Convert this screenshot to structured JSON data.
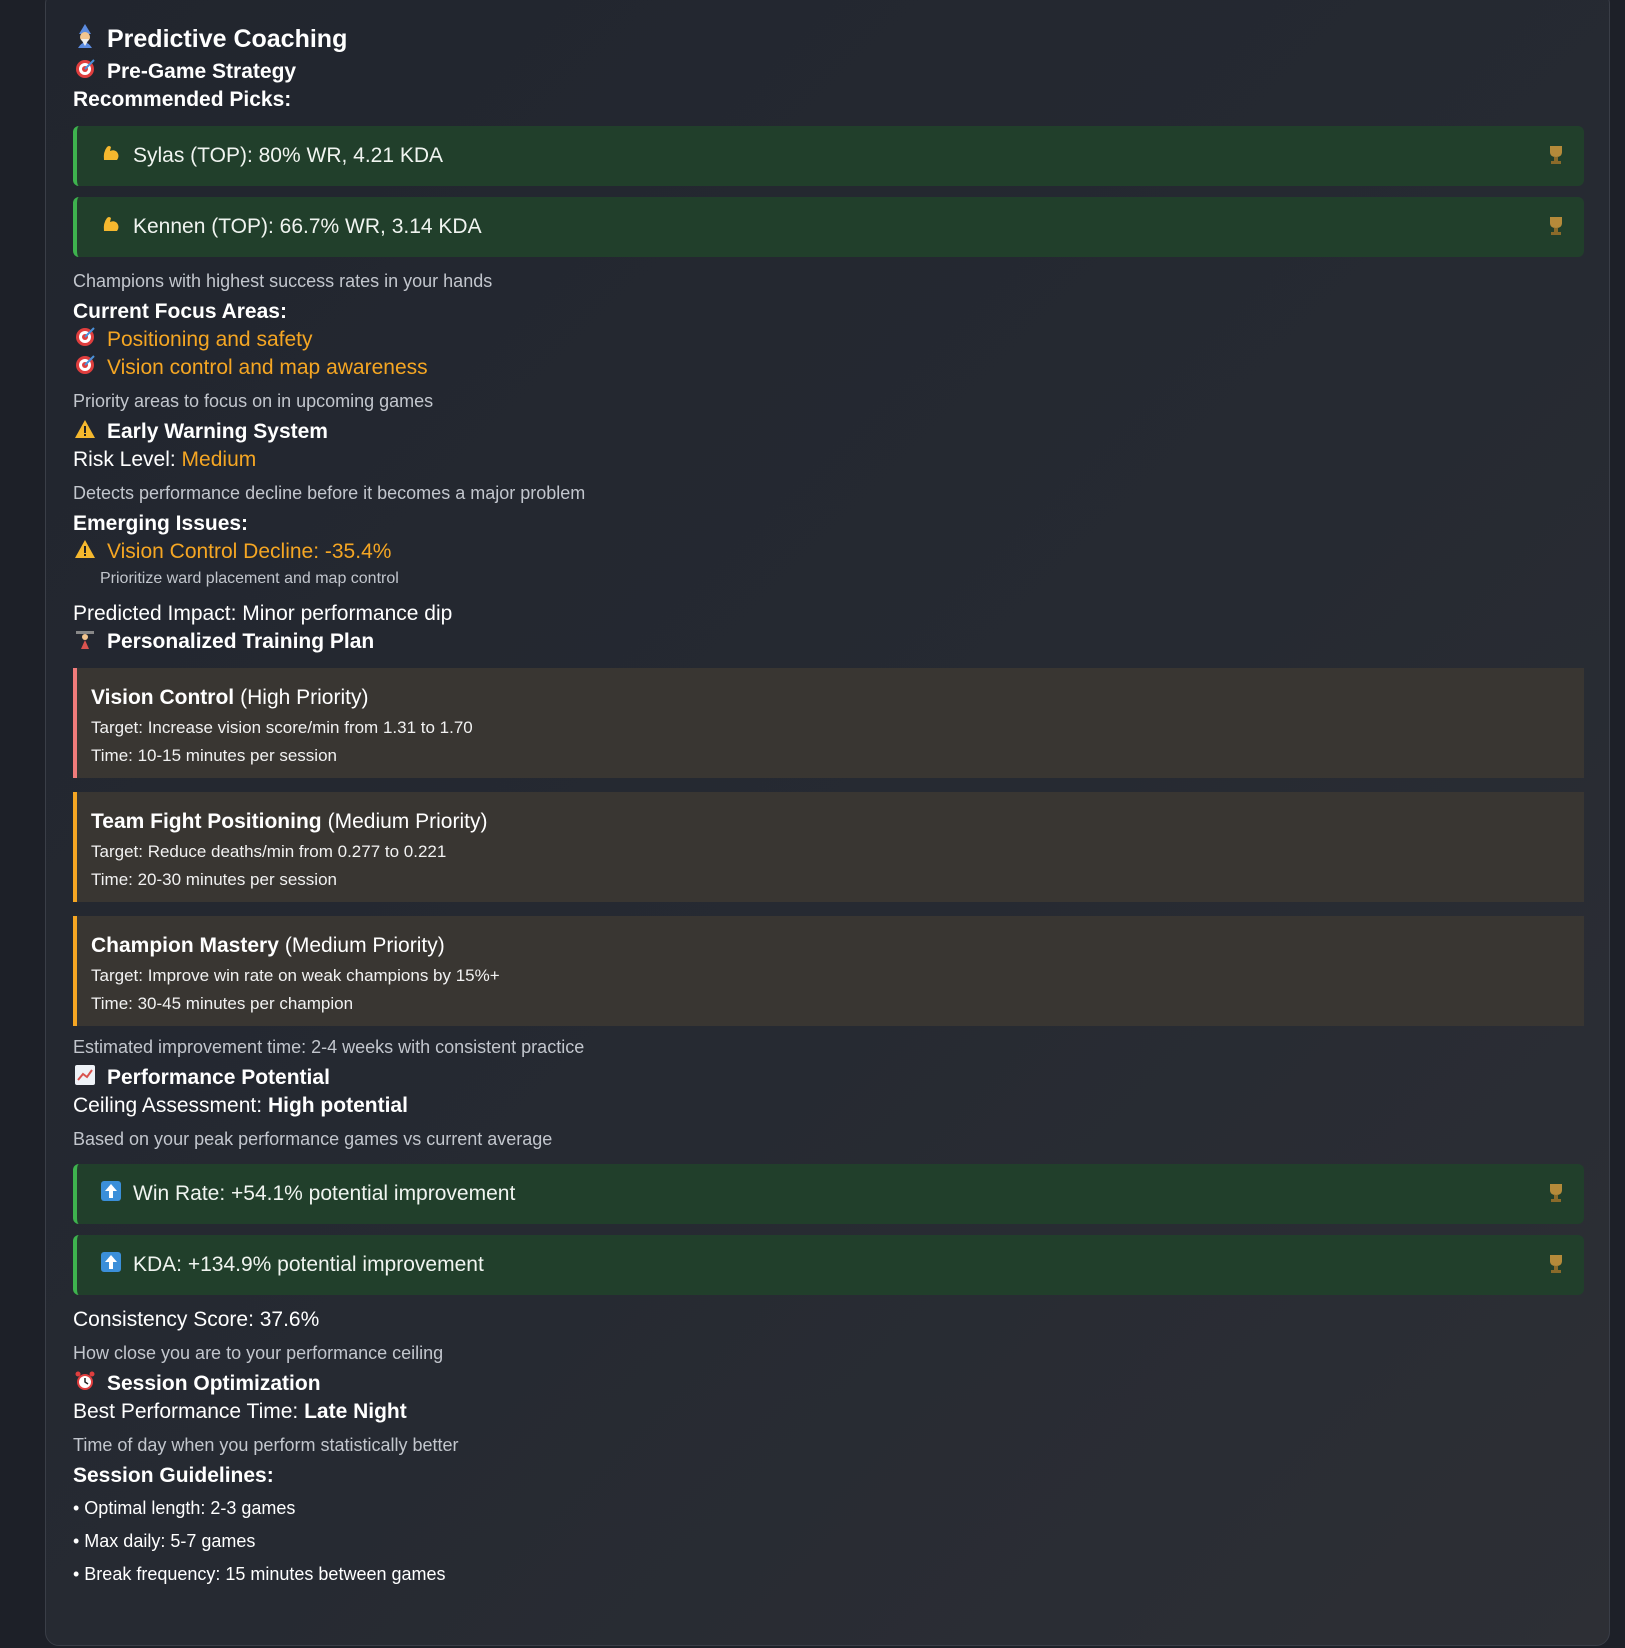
{
  "header": {
    "title": "Predictive Coaching",
    "title_icon": "mage-icon"
  },
  "pregame": {
    "heading": "Pre-Game Strategy",
    "picks_label": "Recommended Picks:",
    "picks": [
      {
        "text": "Sylas (TOP): 80% WR, 4.21 KDA"
      },
      {
        "text": "Kennen (TOP): 66.7% WR, 3.14 KDA"
      }
    ],
    "picks_note": "Champions with highest success rates in your hands",
    "focus_label": "Current Focus Areas:",
    "focus_areas": [
      "Positioning and safety",
      "Vision control and map awareness"
    ],
    "focus_note": "Priority areas to focus on in upcoming games"
  },
  "warning": {
    "heading": "Early Warning System",
    "risk_label": "Risk Level:",
    "risk_value": "Medium",
    "note": "Detects performance decline before it becomes a major problem",
    "issues_label": "Emerging Issues:",
    "issue": "Vision Control Decline: -35.4%",
    "issue_note": "Prioritize ward placement and map control",
    "impact": "Predicted Impact: Minor performance dip"
  },
  "training": {
    "heading": "Personalized Training Plan",
    "items": [
      {
        "name": "Vision Control",
        "priority": "(High Priority)",
        "target": "Target: Increase vision score/min from 1.31 to 1.70",
        "time": "Time: 10-15 minutes per session"
      },
      {
        "name": "Team Fight Positioning",
        "priority": "(Medium Priority)",
        "target": "Target: Reduce deaths/min from 0.277 to 0.221",
        "time": "Time: 20-30 minutes per session"
      },
      {
        "name": "Champion Mastery",
        "priority": "(Medium Priority)",
        "target": "Target: Improve win rate on weak champions by 15%+",
        "time": "Time: 30-45 minutes per champion"
      }
    ],
    "note": "Estimated improvement time: 2-4 weeks with consistent practice"
  },
  "potential": {
    "heading": "Performance Potential",
    "ceiling_label": "Ceiling Assessment:",
    "ceiling_value": "High potential",
    "note": "Based on your peak performance games vs current average",
    "improvements": [
      {
        "text": "Win Rate: +54.1% potential improvement"
      },
      {
        "text": "KDA: +134.9% potential improvement"
      }
    ],
    "consistency": "Consistency Score: 37.6%",
    "consistency_note": "How close you are to your performance ceiling"
  },
  "session": {
    "heading": "Session Optimization",
    "best_label": "Best Performance Time:",
    "best_value": "Late Night",
    "note": "Time of day when you perform statistically better",
    "guidelines_label": "Session Guidelines:",
    "guidelines": [
      "• Optimal length: 2-3 games",
      "• Max daily: 5-7 games",
      "• Break frequency: 15 minutes between games"
    ]
  },
  "colors": {
    "accent_orange": "#f5a623",
    "card_green": "#213f2b",
    "border_green": "#3eb34e",
    "high_priority": "#f07b7b"
  }
}
